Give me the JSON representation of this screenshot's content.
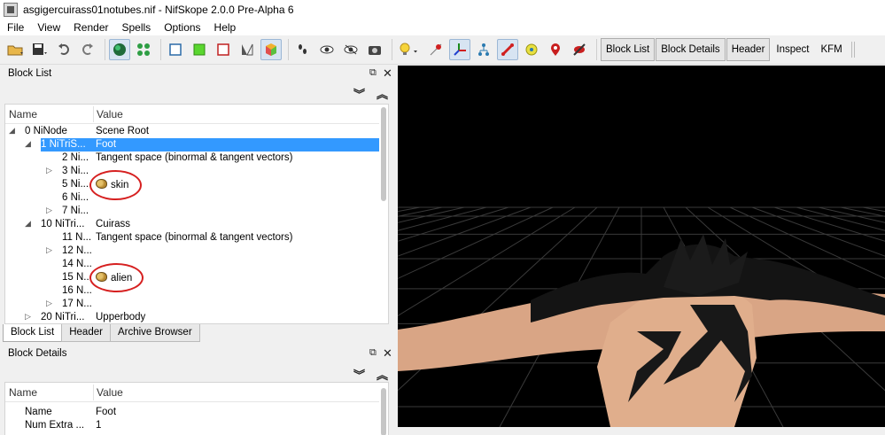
{
  "window": {
    "title": "asgigercuirass01notubes.nif - NifSkope 2.0.0 Pre-Alpha 6"
  },
  "menu": [
    "File",
    "View",
    "Render",
    "Spells",
    "Options",
    "Help"
  ],
  "toolbar": {
    "text_buttons": [
      "Block List",
      "Block Details",
      "Header",
      "Inspect",
      "KFM"
    ]
  },
  "block_list": {
    "title": "Block List",
    "columns": {
      "name": "Name",
      "value": "Value"
    },
    "rows": [
      {
        "name": "0 NiNode",
        "value": "Scene Root",
        "indent": 0,
        "expander": "open"
      },
      {
        "name": "1 NiTriS...",
        "value": "Foot",
        "indent": 1,
        "expander": "open",
        "selected": true
      },
      {
        "name": "2 Ni...",
        "value": "Tangent space (binormal & tangent vectors)",
        "indent": 2,
        "expander": "none"
      },
      {
        "name": "3 Ni...",
        "value": "",
        "indent": 2,
        "expander": "closed"
      },
      {
        "name": "5 Ni...",
        "value": "skin",
        "indent": 2,
        "expander": "none",
        "icon": "palette-icon",
        "highlight": true
      },
      {
        "name": "6 Ni...",
        "value": "",
        "indent": 2,
        "expander": "none"
      },
      {
        "name": "7 Ni...",
        "value": "",
        "indent": 2,
        "expander": "closed"
      },
      {
        "name": "10 NiTri...",
        "value": "Cuirass",
        "indent": 1,
        "expander": "open"
      },
      {
        "name": "11 N...",
        "value": "Tangent space (binormal & tangent vectors)",
        "indent": 2,
        "expander": "none"
      },
      {
        "name": "12 N...",
        "value": "",
        "indent": 2,
        "expander": "closed"
      },
      {
        "name": "14 N...",
        "value": "",
        "indent": 2,
        "expander": "none"
      },
      {
        "name": "15 N...",
        "value": "alien",
        "indent": 2,
        "expander": "none",
        "icon": "palette-icon",
        "highlight": true
      },
      {
        "name": "16 N...",
        "value": "",
        "indent": 2,
        "expander": "none"
      },
      {
        "name": "17 N...",
        "value": "",
        "indent": 2,
        "expander": "closed"
      },
      {
        "name": "20 NiTri...",
        "value": "Upperbody",
        "indent": 1,
        "expander": "closed"
      }
    ]
  },
  "bottom_tabs": [
    "Block List",
    "Header",
    "Archive Browser"
  ],
  "block_details": {
    "title": "Block Details",
    "columns": {
      "name": "Name",
      "value": "Value"
    },
    "rows": [
      {
        "name": "Name",
        "value": "Foot"
      },
      {
        "name": "Num Extra ...",
        "value": "1"
      }
    ]
  },
  "colors": {
    "selection": "#3399ff",
    "highlight_circle": "#d62020",
    "viewport_bg": "#000000",
    "grid": "#3a3a3a",
    "skin": "#d9a585"
  }
}
